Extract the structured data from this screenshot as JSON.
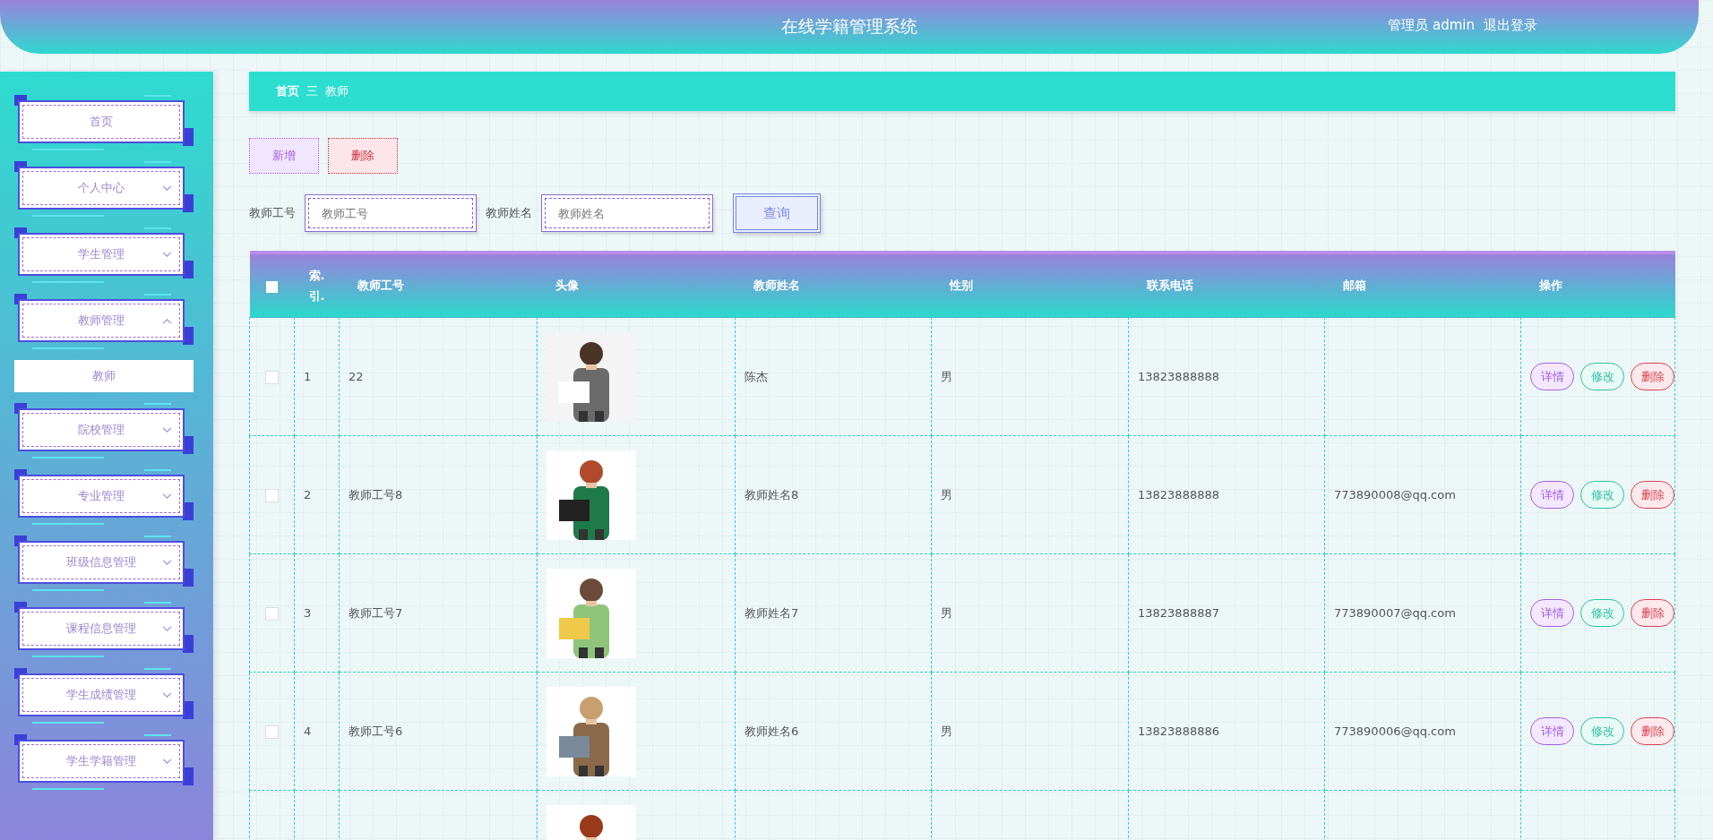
{
  "header": {
    "title": "在线学籍管理系统",
    "user": "管理员 admin",
    "logout": "退出登录"
  },
  "sidebar": {
    "items": [
      {
        "label": "首页",
        "kind": "link",
        "selected": false
      },
      {
        "label": "个人中心",
        "kind": "menu",
        "expanded": false
      },
      {
        "label": "学生管理",
        "kind": "menu",
        "expanded": false
      },
      {
        "label": "教师管理",
        "kind": "menu",
        "expanded": true,
        "children": [
          {
            "label": "教师",
            "selected": true
          }
        ]
      },
      {
        "label": "院校管理",
        "kind": "menu",
        "expanded": false
      },
      {
        "label": "专业管理",
        "kind": "menu",
        "expanded": false
      },
      {
        "label": "班级信息管理",
        "kind": "menu",
        "expanded": false
      },
      {
        "label": "课程信息管理",
        "kind": "menu",
        "expanded": false
      },
      {
        "label": "学生成绩管理",
        "kind": "menu",
        "expanded": false
      },
      {
        "label": "学生学籍管理",
        "kind": "menu",
        "expanded": false
      }
    ]
  },
  "breadcrumb": {
    "items": [
      "首页",
      "教师"
    ],
    "separator": "三"
  },
  "toolbar": [
    {
      "label": "新增",
      "kind": "add"
    },
    {
      "label": "删除",
      "kind": "delete"
    }
  ],
  "search": {
    "fields": [
      {
        "label": "教师工号",
        "placeholder": "教师工号"
      },
      {
        "label": "教师姓名",
        "placeholder": "教师姓名"
      }
    ],
    "button": "查询"
  },
  "table": {
    "select_all": {
      "checked": false
    },
    "columns": [
      "索.引.",
      "教师工号",
      "头像",
      "教师姓名",
      "性别",
      "联系电话",
      "邮箱",
      "操作"
    ],
    "rows": [
      {
        "checked": false,
        "index": "1",
        "id": "22",
        "avatar": {
          "kind": "picture"
        },
        "name": "陈杰",
        "gender": "男",
        "phone": "13823888888",
        "email": "",
        "actions": [
          "详情",
          "修改",
          "删除"
        ]
      },
      {
        "checked": false,
        "index": "2",
        "id": "教师工号8",
        "avatar": {
          "kind": "picture"
        },
        "name": "教师姓名8",
        "gender": "男",
        "phone": "13823888888",
        "email": "773890008@qq.com",
        "actions": [
          "详情",
          "修改",
          "删除"
        ]
      },
      {
        "checked": false,
        "index": "3",
        "id": "教师工号7",
        "avatar": {
          "kind": "picture"
        },
        "name": "教师姓名7",
        "gender": "男",
        "phone": "13823888887",
        "email": "773890007@qq.com",
        "actions": [
          "详情",
          "修改",
          "删除"
        ]
      },
      {
        "checked": false,
        "index": "4",
        "id": "教师工号6",
        "avatar": {
          "kind": "picture"
        },
        "name": "教师姓名6",
        "gender": "男",
        "phone": "13823888886",
        "email": "773890006@qq.com",
        "actions": [
          "详情",
          "修改",
          "删除"
        ]
      },
      {
        "avatar": {
          "kind": "picture"
        }
      }
    ]
  }
}
